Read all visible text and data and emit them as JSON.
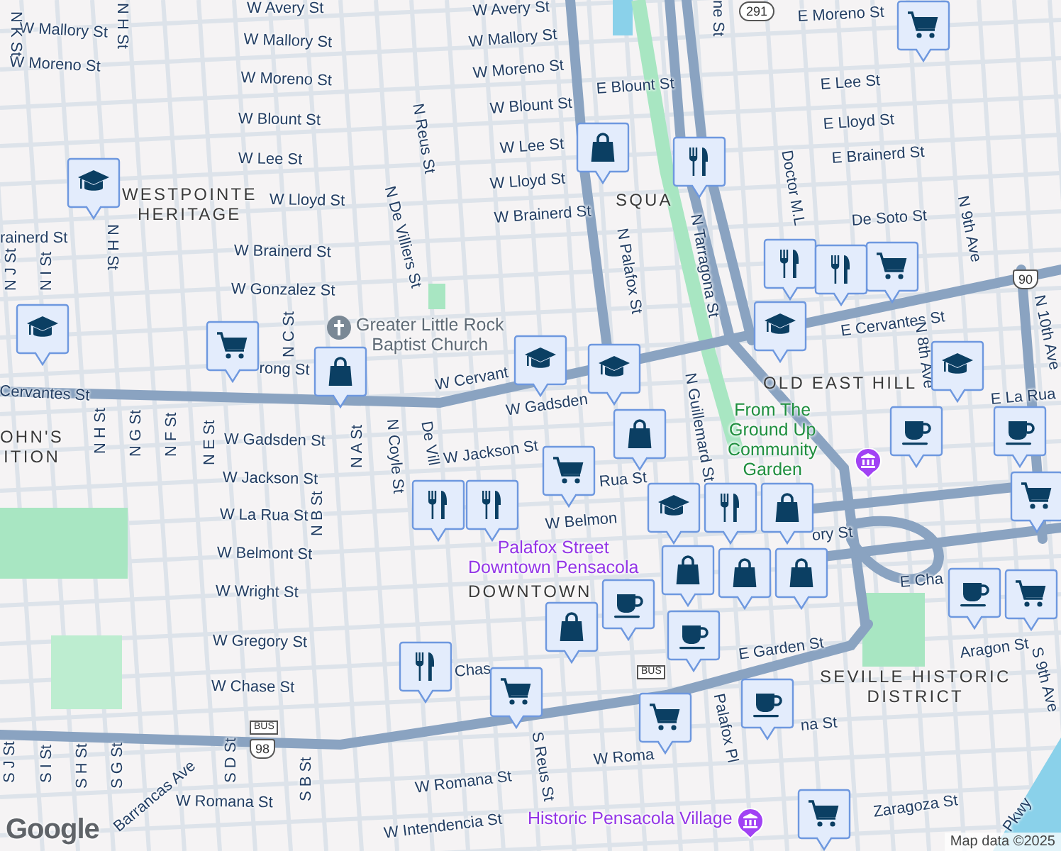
{
  "map": {
    "streets": [
      {
        "text": "W Avery St"
      },
      {
        "text": "W Avery St"
      },
      {
        "text": "W Mallory St"
      },
      {
        "text": "W Mallory St"
      },
      {
        "text": "W Mallory St"
      },
      {
        "text": "W Moreno St"
      },
      {
        "text": "W Moreno St"
      },
      {
        "text": "W Moreno St"
      },
      {
        "text": "W Blount St"
      },
      {
        "text": "W Blount St"
      },
      {
        "text": "E Blount St"
      },
      {
        "text": "E Moreno St"
      },
      {
        "text": "W Lee St"
      },
      {
        "text": "W Lee St"
      },
      {
        "text": "E Lee St"
      },
      {
        "text": "W Lloyd St"
      },
      {
        "text": "W Lloyd St"
      },
      {
        "text": "E Lloyd St"
      },
      {
        "text": "rainerd St"
      },
      {
        "text": "W Brainerd St"
      },
      {
        "text": "W Brainerd St"
      },
      {
        "text": "E Brainerd St"
      },
      {
        "text": "W Gonzalez St"
      },
      {
        "text": "De Soto St"
      },
      {
        "text": "rong St"
      },
      {
        "text": "Cervantes St"
      },
      {
        "text": "W Cervant"
      },
      {
        "text": "E Cervantes St"
      },
      {
        "text": "W Gadsden"
      },
      {
        "text": "W Gadsden St"
      },
      {
        "text": "W Jackson St"
      },
      {
        "text": "W Jackson St"
      },
      {
        "text": "W La Rua St"
      },
      {
        "text": "Rua St"
      },
      {
        "text": "W Belmont St"
      },
      {
        "text": "W Belmon"
      },
      {
        "text": "W Wright St"
      },
      {
        "text": "ory St"
      },
      {
        "text": "W Gregory St"
      },
      {
        "text": "W Chase St"
      },
      {
        "text": "Chas"
      },
      {
        "text": "E Cha"
      },
      {
        "text": "Aragon St"
      },
      {
        "text": "E Garden St"
      },
      {
        "text": "W Romana St"
      },
      {
        "text": "W Romana St"
      },
      {
        "text": "W Roma"
      },
      {
        "text": "na St"
      },
      {
        "text": "W Intendencia St"
      },
      {
        "text": "Zaragoza St"
      },
      {
        "text": "E La Rua"
      },
      {
        "text": "Pkwy"
      },
      {
        "text": "N K St"
      },
      {
        "text": "N H St"
      },
      {
        "text": "N H St"
      },
      {
        "text": "N Reus St"
      },
      {
        "text": "N De Villiers St"
      },
      {
        "text": "ne St"
      },
      {
        "text": "Doctor M.L"
      },
      {
        "text": "N Palafox St"
      },
      {
        "text": "N Tarragona St"
      },
      {
        "text": "N 9th Ave"
      },
      {
        "text": "N 10th Ave"
      },
      {
        "text": "N 8th Ave"
      },
      {
        "text": "N C St"
      },
      {
        "text": "N E St"
      },
      {
        "text": "N G St"
      },
      {
        "text": "N F St"
      },
      {
        "text": "N H St"
      },
      {
        "text": "N B St"
      },
      {
        "text": "N A St"
      },
      {
        "text": "N Coyle St"
      },
      {
        "text": "De Vill"
      },
      {
        "text": "N Guillemard St"
      },
      {
        "text": "S Reus St"
      },
      {
        "text": "Palafox Pl"
      },
      {
        "text": "S 9th Ave"
      },
      {
        "text": "S J St"
      },
      {
        "text": "S I St"
      },
      {
        "text": "S H St"
      },
      {
        "text": "S G St"
      },
      {
        "text": "S D St"
      },
      {
        "text": "S B St"
      },
      {
        "text": "N J St"
      },
      {
        "text": "N I St"
      },
      {
        "text": "Barrancas Ave"
      }
    ],
    "areas": [
      {
        "lines": [
          "WESTPOINTE",
          "HERITAGE"
        ]
      },
      {
        "lines": [
          "SQUA"
        ]
      },
      {
        "lines": [
          "OHN'S",
          "ITION"
        ]
      },
      {
        "lines": [
          "OLD EAST HILL"
        ]
      },
      {
        "lines": [
          "DOWNTOWN"
        ]
      },
      {
        "lines": [
          "SEVILLE HISTORIC",
          "DISTRICT"
        ]
      }
    ],
    "places": [
      {
        "kind": "church",
        "lines": [
          "Greater Little Rock",
          "Baptist Church"
        ]
      },
      {
        "kind": "garden",
        "lines": [
          "From The",
          "Ground Up",
          "Community",
          "Garden"
        ]
      },
      {
        "kind": "museum"
      },
      {
        "kind": "attraction",
        "lines": [
          "Palafox Street",
          "Downtown Pensacola"
        ]
      },
      {
        "kind": "museum",
        "lines": [
          "Historic Pensacola Village"
        ]
      }
    ],
    "shields": [
      {
        "kind": "state",
        "text": "291"
      },
      {
        "kind": "us",
        "text": "90"
      },
      {
        "kind": "bus",
        "text": "BUS"
      },
      {
        "kind": "us",
        "text": "98"
      },
      {
        "kind": "bus",
        "text": "BUS"
      }
    ],
    "markers": [
      {
        "kind": "grocery"
      },
      {
        "kind": "shop"
      },
      {
        "kind": "food"
      },
      {
        "kind": "school"
      },
      {
        "kind": "food"
      },
      {
        "kind": "grocery"
      },
      {
        "kind": "food"
      },
      {
        "kind": "school"
      },
      {
        "kind": "school"
      },
      {
        "kind": "shop"
      },
      {
        "kind": "grocery"
      },
      {
        "kind": "school"
      },
      {
        "kind": "school"
      },
      {
        "kind": "school"
      },
      {
        "kind": "shop"
      },
      {
        "kind": "cafe"
      },
      {
        "kind": "cafe"
      },
      {
        "kind": "grocery"
      },
      {
        "kind": "food"
      },
      {
        "kind": "food"
      },
      {
        "kind": "school"
      },
      {
        "kind": "food"
      },
      {
        "kind": "grocery"
      },
      {
        "kind": "shop"
      },
      {
        "kind": "shop"
      },
      {
        "kind": "cafe"
      },
      {
        "kind": "shop"
      },
      {
        "kind": "shop"
      },
      {
        "kind": "cafe"
      },
      {
        "kind": "grocery"
      },
      {
        "kind": "shop"
      },
      {
        "kind": "food"
      },
      {
        "kind": "cafe"
      },
      {
        "kind": "grocery"
      },
      {
        "kind": "cafe"
      },
      {
        "kind": "grocery"
      },
      {
        "kind": "grocery"
      }
    ],
    "logo": "Google",
    "attribution": "Map data ©2025"
  }
}
